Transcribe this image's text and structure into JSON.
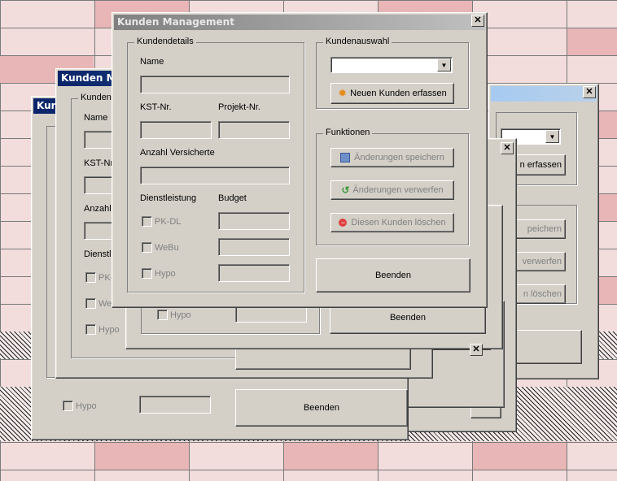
{
  "window": {
    "title": "Kunden Management",
    "title_short_a": "Kunden Ma",
    "title_short_b": "Kun",
    "close": "✕"
  },
  "details": {
    "group_label": "Kundendetails",
    "name_label": "Name",
    "name_label_short": "Name",
    "kst_label": "KST-Nr.",
    "kst_label_short": "KST-Nr",
    "projekt_label": "Projekt-Nr.",
    "versicherte_label": "Anzahl Versicherte",
    "versicherte_label_short": "Anzahl",
    "dienstleistung_label": "Dienstleistung",
    "dienstleistung_label_short": "Dienstl",
    "budget_label": "Budget",
    "group_label_short": "Kunden",
    "options": [
      "PK-DL",
      "WeBu",
      "Hypo"
    ],
    "option_short_pk": "PK-",
    "option_short_we": "We"
  },
  "auswahl": {
    "group_label": "Kundenauswahl",
    "combo_value": "",
    "new_button": "Neuen Kunden erfassen",
    "new_button_partial": "n erfassen"
  },
  "funktionen": {
    "group_label": "Funktionen",
    "save": "Änderungen speichern",
    "discard": "Änderungen verwerfen",
    "delete": "Diesen Kunden löschen",
    "save_partial": "peichern",
    "discard_partial": "verwerfen",
    "delete_partial": "n löschen"
  },
  "beenden": "Beenden",
  "colors": {
    "face": "#d4d0c8",
    "title_blue": "#0a246a",
    "title_inactive": "#808080"
  }
}
